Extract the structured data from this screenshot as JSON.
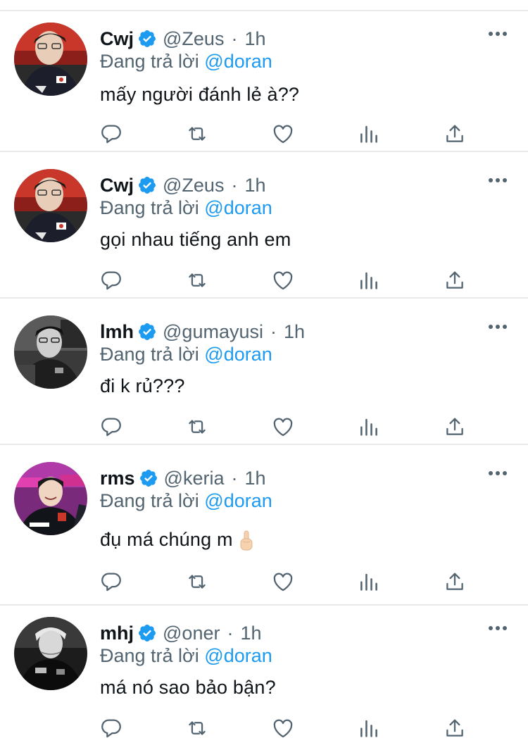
{
  "colors": {
    "text": "#0f1419",
    "secondary": "#536471",
    "link": "#1d9bf0",
    "divider": "#e7e9ea",
    "verified": "#1d9bf0"
  },
  "common": {
    "dot": "·",
    "replying_prefix": "Đang trả lời",
    "replying_to": "@doran"
  },
  "tweets": [
    {
      "name": "Cwj",
      "handle": "@Zeus",
      "time": "1h",
      "text": "mấy người đánh lẻ à??",
      "avatar": "avatar-zeus"
    },
    {
      "name": "Cwj",
      "handle": "@Zeus",
      "time": "1h",
      "text": "gọi nhau tiếng anh em",
      "avatar": "avatar-zeus"
    },
    {
      "name": "lmh",
      "handle": "@gumayusi",
      "time": "1h",
      "text": "đi k rủ???",
      "avatar": "avatar-gumayusi"
    },
    {
      "name": "rms",
      "handle": "@keria",
      "time": "1h",
      "text": "đụ má chúng m",
      "emoji": "middle-finger-emoji",
      "avatar": "avatar-keria"
    },
    {
      "name": "mhj",
      "handle": "@oner",
      "time": "1h",
      "text": "má nó sao bảo bận?",
      "avatar": "avatar-oner"
    }
  ],
  "icons": {
    "reply": "reply-icon",
    "retweet": "retweet-icon",
    "like": "like-icon",
    "views": "views-icon",
    "share": "share-icon",
    "more": "more-icon",
    "verified": "verified-badge-icon"
  }
}
